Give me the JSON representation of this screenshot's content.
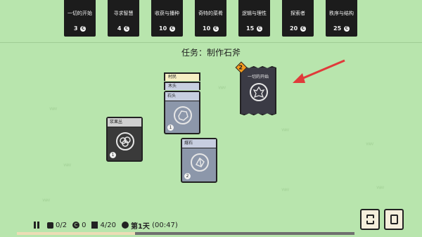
{
  "packs": [
    {
      "name": "一切的开始",
      "cost": "3"
    },
    {
      "name": "寻求智慧",
      "cost": "4"
    },
    {
      "name": "收获与播种",
      "cost": "10"
    },
    {
      "name": "奇特的菜肴",
      "cost": "10"
    },
    {
      "name": "逻辑与理性",
      "cost": "15"
    },
    {
      "name": "探索者",
      "cost": "20"
    },
    {
      "name": "秩序与结构",
      "cost": "25"
    }
  ],
  "coin_symbol": "C",
  "quest": {
    "text": "任务：制作石斧"
  },
  "cards": {
    "berry_bush": {
      "label": "浆果丛",
      "count": "1"
    },
    "stack": {
      "villager": "村民",
      "wood": "木头",
      "stone": "石头",
      "count": "1"
    },
    "flint": {
      "label": "燧石",
      "count": "2"
    }
  },
  "booster": {
    "label": "一切的开始",
    "badge": "2"
  },
  "hud": {
    "food": "0/2",
    "coins": "0",
    "cards": "4/20",
    "day": "第1天",
    "time": "(00:47)"
  },
  "progress": {
    "fraction": 0.35
  },
  "colors": {
    "arrow": "#e03a3a",
    "board": "#b8e5ad",
    "badge": "#f39a1d"
  },
  "icons": [
    "pause-icon",
    "food-icon",
    "coin-icon",
    "cards-icon",
    "moon-icon",
    "ideas-icon",
    "card-book-icon"
  ]
}
